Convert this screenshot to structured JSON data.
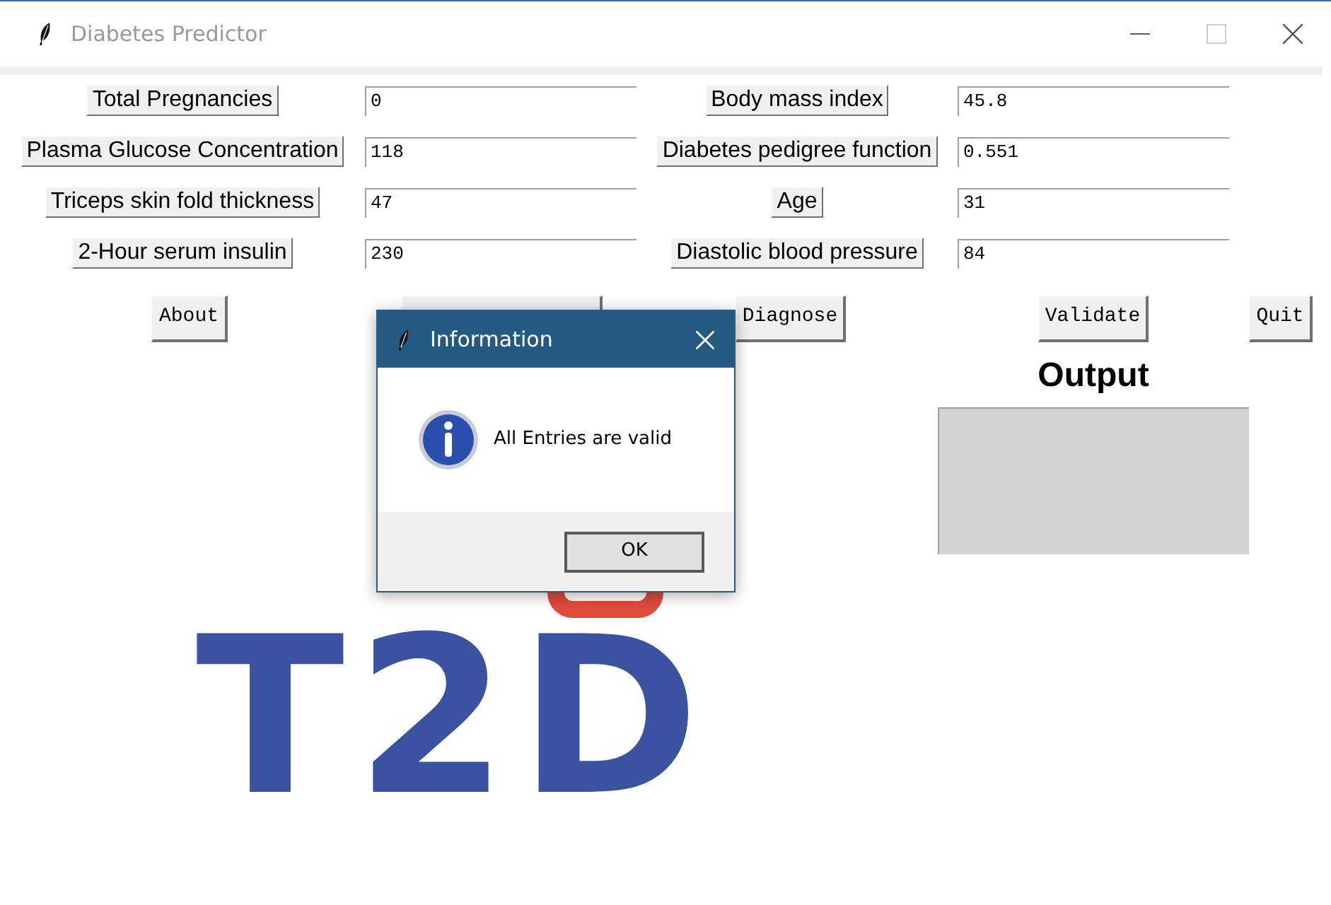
{
  "window": {
    "title": "Diabetes Predictor"
  },
  "fields": [
    {
      "label": "Total Pregnancies",
      "value": "0"
    },
    {
      "label": "Body mass index",
      "value": "45.8"
    },
    {
      "label": "Plasma Glucose Concentration",
      "value": "118"
    },
    {
      "label": "Diabetes pedigree function",
      "value": "0.551"
    },
    {
      "label": "Triceps skin fold thickness",
      "value": "47"
    },
    {
      "label": "Age",
      "value": "31"
    },
    {
      "label": "2-Hour serum insulin",
      "value": "230"
    },
    {
      "label": "Diastolic blood pressure",
      "value": "84"
    }
  ],
  "actions": [
    "About",
    "Diagnose",
    "Validate",
    "Quit"
  ],
  "output": {
    "title": "Output"
  },
  "logo": {
    "text": "T2D"
  },
  "dialog": {
    "title": "Information",
    "message": "All Entries are valid",
    "button": "OK"
  }
}
